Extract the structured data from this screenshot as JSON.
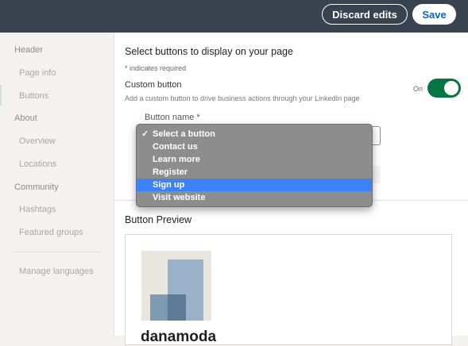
{
  "topbar": {
    "discard_label": "Discard edits",
    "save_label": "Save"
  },
  "sidebar": {
    "sections": [
      {
        "label": "Header",
        "items": [
          "Page info",
          "Buttons"
        ]
      },
      {
        "label": "About",
        "items": [
          "Overview",
          "Locations"
        ]
      },
      {
        "label": "Community",
        "items": [
          "Hashtags",
          "Featured groups"
        ]
      }
    ],
    "footer_item": "Manage languages",
    "active_item": "Buttons"
  },
  "main": {
    "title": "Select buttons to display on your page",
    "required_star": "*",
    "required_note": "indicates required",
    "custom_button": {
      "label": "Custom button",
      "description": "Add a custom button to drive business actions through your LinkedIn page",
      "toggle_state": "On",
      "enabled": true
    },
    "button_name_label": "Button name *",
    "dropdown": {
      "selected": "Select a button",
      "check": "✓",
      "options": [
        "Select a button",
        "Contact us",
        "Learn more",
        "Register",
        "Sign up",
        "Visit website"
      ],
      "highlighted": "Sign up"
    },
    "preview_label": "Button Preview",
    "company_name": "danamoda"
  },
  "colors": {
    "topbar": "#38434f",
    "save_text": "#0a66c2",
    "toggle_on": "#057642",
    "highlight": "#3b82f6"
  }
}
